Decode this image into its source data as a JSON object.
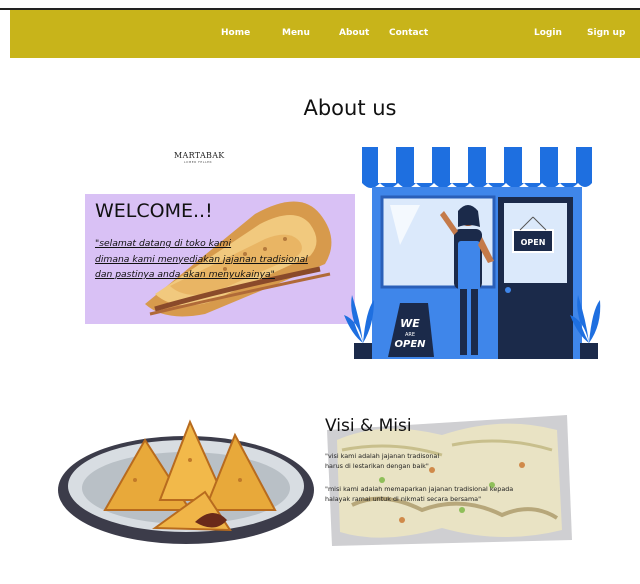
{
  "nav": {
    "home": "Home",
    "menu": "Menu",
    "about": "About",
    "contact": "Contact",
    "login": "Login",
    "signup": "Sign up",
    "bar_color": "#c8b41a"
  },
  "about_title": "About us",
  "brand": {
    "name": "MARTABAK",
    "tagline": "LUMER FELLER"
  },
  "welcome": {
    "title": "WELCOME..!",
    "lines": [
      "\"selamat datang di toko kami",
      "dimana kami menyediakan jajanan tradisional",
      "dan pastinya anda akan menyukainya\""
    ],
    "panel_color": "#d9c1f5"
  },
  "shop_sign": {
    "open": "OPEN",
    "board_we": "WE",
    "board_are": "ARE",
    "board_open": "OPEN"
  },
  "visi_misi": {
    "title": "Visi & Misi",
    "visi_lines": [
      "\"visi kami adalah jajanan tradisonal",
      "harus di lestarikan dengan baik\""
    ],
    "misi_lines": [
      "\"misi kami adalah memaparkan jajanan tradisional kepada",
      "halayak ramai untuk di nikmati secara bersama\""
    ]
  }
}
